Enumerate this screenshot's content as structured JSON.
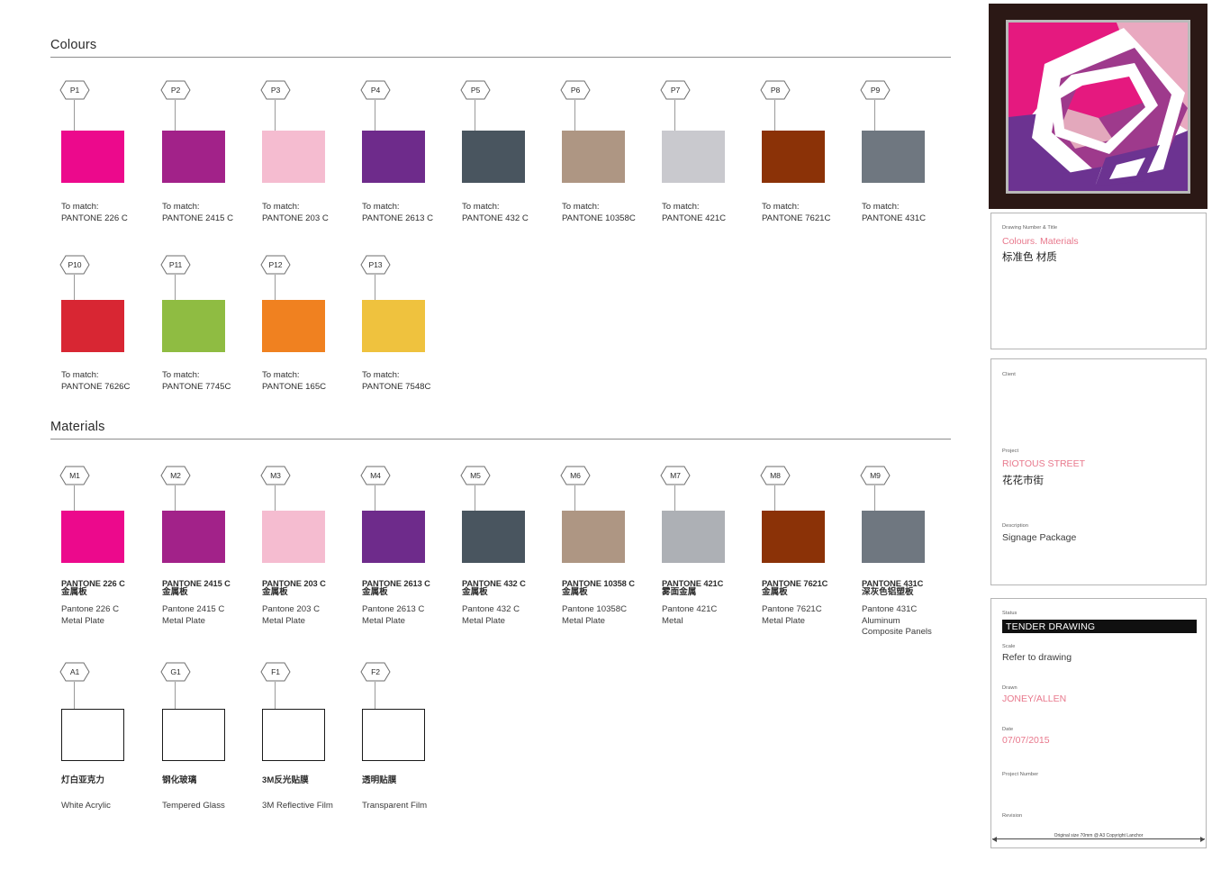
{
  "sheet": {
    "sections": [
      {
        "key": "colours",
        "title": "Colours"
      },
      {
        "key": "materials",
        "title": "Materials"
      }
    ]
  },
  "colours": {
    "prefix": "To match:",
    "items": [
      {
        "tag": "P1",
        "color": "#ec098c",
        "line1": "To match:",
        "line2": "PANTONE 226 C"
      },
      {
        "tag": "P2",
        "color": "#a22289",
        "line1": "To match:",
        "line2": "PANTONE 2415 C"
      },
      {
        "tag": "P3",
        "color": "#f5bcd0",
        "line1": "To match:",
        "line2": "PANTONE 203 C"
      },
      {
        "tag": "P4",
        "color": "#6e2b8b",
        "line1": "To match:",
        "line2": "PANTONE 2613 C"
      },
      {
        "tag": "P5",
        "color": "#49555f",
        "line1": "To match:",
        "line2": "PANTONE 432 C"
      },
      {
        "tag": "P6",
        "color": "#ae9683",
        "line1": "To match:",
        "line2": "PANTONE 10358C"
      },
      {
        "tag": "P7",
        "color": "#c9c9ce",
        "line1": "To match:",
        "line2": "PANTONE 421C"
      },
      {
        "tag": "P8",
        "color": "#8b3207",
        "line1": "To match:",
        "line2": "PANTONE 7621C"
      },
      {
        "tag": "P9",
        "color": "#6f7780",
        "line1": "To match:",
        "line2": "PANTONE 431C"
      },
      {
        "tag": "P10",
        "color": "#d82633",
        "line1": "To match:",
        "line2": "PANTONE 7626C"
      },
      {
        "tag": "P11",
        "color": "#8fbc42",
        "line1": "To match:",
        "line2": "PANTONE 7745C"
      },
      {
        "tag": "P12",
        "color": "#f08120",
        "line1": "To match:",
        "line2": "PANTONE 165C"
      },
      {
        "tag": "P13",
        "color": "#efc23e",
        "line1": "To match:",
        "line2": "PANTONE 7548C"
      }
    ]
  },
  "materials": {
    "items": [
      {
        "tag": "M1",
        "color": "#ec098c",
        "name_en": "PANTONE 226 C",
        "name_cn": "金属板",
        "desc": "Pantone 226 C\nMetal Plate"
      },
      {
        "tag": "M2",
        "color": "#a22289",
        "name_en": "PANTONE 2415 C",
        "name_cn": "金属板",
        "desc": "Pantone 2415 C\nMetal Plate"
      },
      {
        "tag": "M3",
        "color": "#f5bcd0",
        "name_en": "PANTONE 203 C",
        "name_cn": "金属板",
        "desc": "Pantone 203 C\nMetal Plate"
      },
      {
        "tag": "M4",
        "color": "#6e2b8b",
        "name_en": "PANTONE 2613 C",
        "name_cn": "金属板",
        "desc": "Pantone 2613 C\nMetal Plate"
      },
      {
        "tag": "M5",
        "color": "#49555f",
        "name_en": "PANTONE 432 C",
        "name_cn": "金属板",
        "desc": "Pantone 432 C\nMetal Plate"
      },
      {
        "tag": "M6",
        "color": "#ae9683",
        "name_en": "PANTONE 10358 C",
        "name_cn": "金属板",
        "desc": "Pantone 10358C\nMetal Plate"
      },
      {
        "tag": "M7",
        "color": "#adb0b5",
        "name_en": "PANTONE 421C",
        "name_cn": "雾面金属",
        "desc": "Pantone 421C\nMetal"
      },
      {
        "tag": "M8",
        "color": "#8b3207",
        "name_en": "PANTONE 7621C",
        "name_cn": "金属板",
        "desc": "Pantone 7621C\nMetal Plate"
      },
      {
        "tag": "M9",
        "color": "#6f7780",
        "name_en": "PANTONE 431C",
        "name_cn": "深灰色铝塑板",
        "desc": "Pantone 431C\nAluminum\nComposite Panels"
      }
    ],
    "finishes": [
      {
        "tag": "A1",
        "name_cn": "灯白亚克力",
        "name_en": "White Acrylic"
      },
      {
        "tag": "G1",
        "name_cn": "钢化玻璃",
        "name_en": "Tempered Glass"
      },
      {
        "tag": "F1",
        "name_cn": "3M反光贴膜",
        "name_en": "3M Reflective Film"
      },
      {
        "tag": "F2",
        "name_cn": "透明贴膜",
        "name_en": "Transparent Film"
      }
    ]
  },
  "titleblock": {
    "drawing": {
      "label": "Drawing Number & Title",
      "title_en": "Colours. Materials",
      "title_cn": "标准色 材质"
    },
    "client": {
      "label": "Client",
      "value": ""
    },
    "project": {
      "label": "Project",
      "name_en": "RIOTOUS STREET",
      "name_cn": "花花市街"
    },
    "description": {
      "label": "Description",
      "value": "Signage Package"
    },
    "status": {
      "label": "Status",
      "value": "TENDER DRAWING"
    },
    "scale": {
      "label": "Scale",
      "value": "Refer to drawing"
    },
    "drawn": {
      "label": "Drawn",
      "value": "JONEY/ALLEN"
    },
    "date": {
      "label": "Date",
      "value": "07/07/2015"
    },
    "project_number": {
      "label": "Project Number",
      "value": ""
    },
    "revision": {
      "label": "Revision",
      "value": ""
    },
    "scalebar": {
      "label": "Original size 70mm @ A3 Copyright  Lanchor"
    },
    "accent_color": "#e8788c"
  }
}
